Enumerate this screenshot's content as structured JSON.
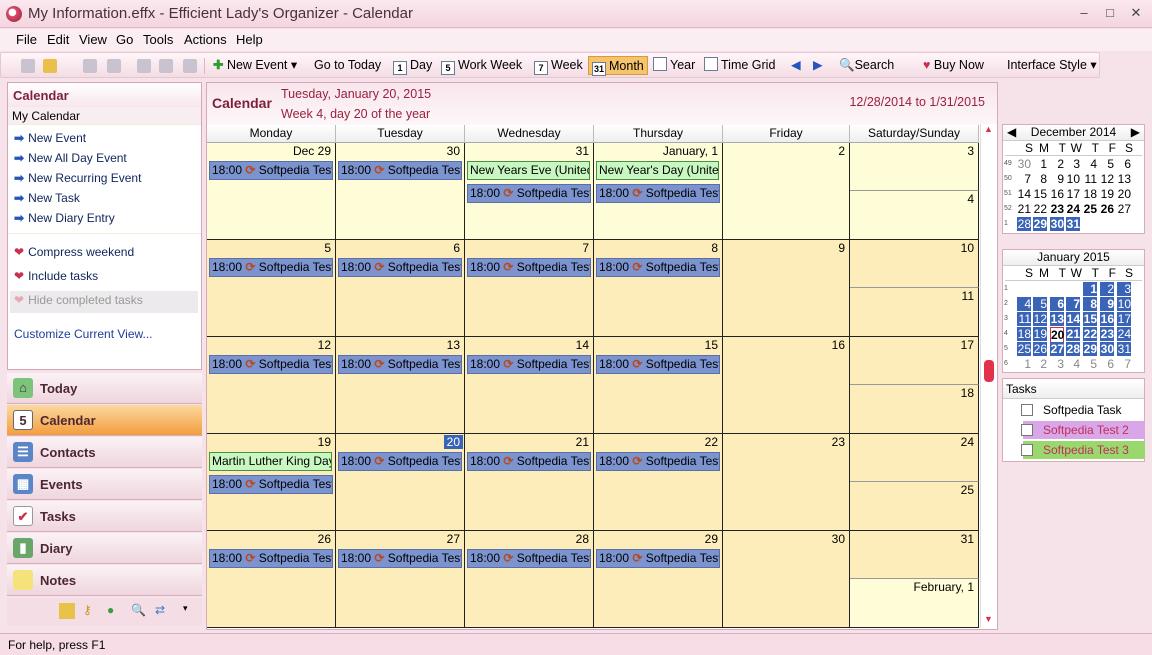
{
  "window": {
    "title": "My Information.effx - Efficient Lady's Organizer - Calendar",
    "min": "–",
    "max": "□",
    "close": "✕"
  },
  "menu": [
    "File",
    "Edit",
    "View",
    "Go",
    "Tools",
    "Actions",
    "Help"
  ],
  "toolbar": {
    "new_event": "New Event",
    "go_today": "Go to Today",
    "day": "Day",
    "work_week": "Work Week",
    "week": "Week",
    "month": "Month",
    "year": "Year",
    "time_grid": "Time Grid",
    "search": "Search",
    "buy_now": "Buy Now",
    "interface_style": "Interface Style",
    "day_num": "1",
    "ww_num": "5",
    "week_num": "7",
    "month_num": "31"
  },
  "left_panel": {
    "title": "Calendar",
    "subtitle": "My Calendar",
    "actions": [
      "New Event",
      "New All Day Event",
      "New Recurring Event",
      "New Task",
      "New Diary Entry"
    ],
    "options": [
      "Compress weekend",
      "Include tasks",
      "Hide completed tasks"
    ],
    "customize": "Customize Current View..."
  },
  "nav": [
    "Today",
    "Calendar",
    "Contacts",
    "Events",
    "Tasks",
    "Diary",
    "Notes"
  ],
  "calendar": {
    "title": "Calendar",
    "date": "Tuesday, January 20, 2015",
    "week": "Week 4, day 20 of the year",
    "range": "12/28/2014 to 1/31/2015",
    "headers": [
      "Monday",
      "Tuesday",
      "Wednesday",
      "Thursday",
      "Friday",
      "Saturday/Sunday"
    ],
    "event_time": "18:00",
    "event_name": "Softpedia Test",
    "weeks": [
      {
        "days": [
          "Dec 29",
          "30",
          "31",
          "January, 1",
          "2"
        ],
        "sat": "3",
        "sun": "4"
      },
      {
        "days": [
          "5",
          "6",
          "7",
          "8",
          "9"
        ],
        "sat": "10",
        "sun": "11"
      },
      {
        "days": [
          "12",
          "13",
          "14",
          "15",
          "16"
        ],
        "sat": "17",
        "sun": "18"
      },
      {
        "days": [
          "19",
          "20",
          "21",
          "22",
          "23"
        ],
        "sat": "24",
        "sun": "25"
      },
      {
        "days": [
          "26",
          "27",
          "28",
          "29",
          "30"
        ],
        "sat": "31",
        "sun": "February, 1"
      }
    ],
    "holidays": {
      "nye": "New Years Eve (United S",
      "nyd": "New Year's Day (United",
      "mlk": "Martin Luther King Day ("
    }
  },
  "mini_dec": {
    "title": "December 2014",
    "dow": [
      "S",
      "M",
      "T",
      "W",
      "T",
      "F",
      "S"
    ],
    "rows": [
      [
        "49",
        "30",
        "1",
        "2",
        "3",
        "4",
        "5",
        "6"
      ],
      [
        "50",
        "7",
        "8",
        "9",
        "10",
        "11",
        "12",
        "13"
      ],
      [
        "51",
        "14",
        "15",
        "16",
        "17",
        "18",
        "19",
        "20"
      ],
      [
        "52",
        "21",
        "22",
        "23",
        "24",
        "25",
        "26",
        "27"
      ],
      [
        "1",
        "28",
        "29",
        "30",
        "31",
        "",
        "",
        ""
      ]
    ]
  },
  "mini_jan": {
    "title": "January 2015",
    "dow": [
      "S",
      "M",
      "T",
      "W",
      "T",
      "F",
      "S"
    ],
    "rows": [
      [
        "1",
        "",
        "",
        "",
        "",
        "1",
        "2",
        "3"
      ],
      [
        "2",
        "4",
        "5",
        "6",
        "7",
        "8",
        "9",
        "10"
      ],
      [
        "3",
        "11",
        "12",
        "13",
        "14",
        "15",
        "16",
        "17"
      ],
      [
        "4",
        "18",
        "19",
        "20",
        "21",
        "22",
        "23",
        "24"
      ],
      [
        "5",
        "25",
        "26",
        "27",
        "28",
        "29",
        "30",
        "31"
      ],
      [
        "6",
        "1",
        "2",
        "3",
        "4",
        "5",
        "6",
        "7"
      ]
    ]
  },
  "tasks": {
    "title": "Tasks",
    "items": [
      "Softpedia Task",
      "Softpedia Test 2",
      "Softpedia Test 3"
    ]
  },
  "status": "For help, press F1"
}
